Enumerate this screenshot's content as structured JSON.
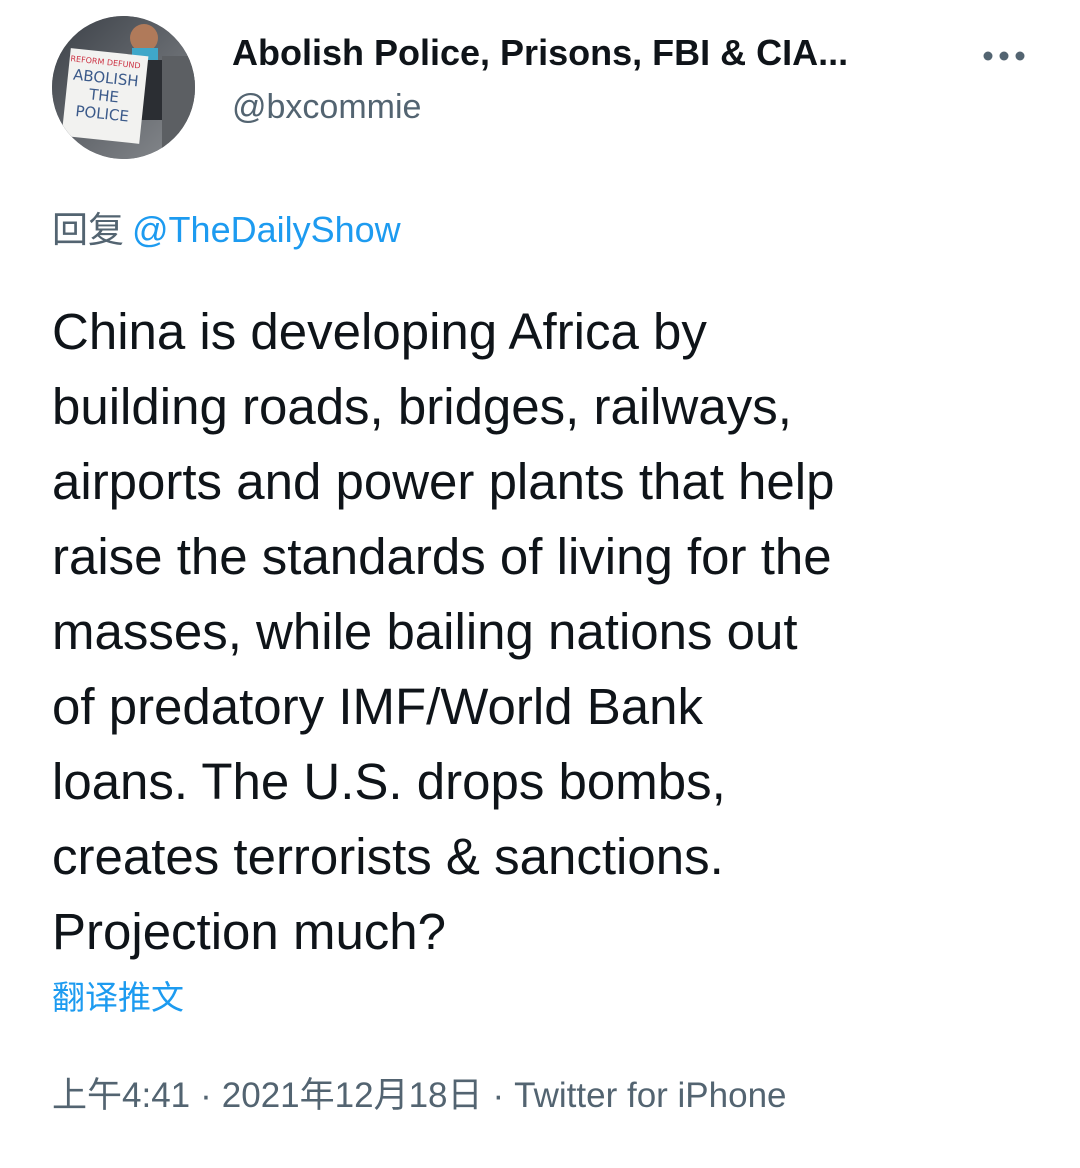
{
  "author": {
    "display_name": "Abolish Police, Prisons, FBI & CIA...",
    "handle": "@bxcommie",
    "avatar_sign_lines": [
      "REFORM DEFUND",
      "ABOLISH",
      "THE",
      "POLICE"
    ]
  },
  "reply": {
    "prefix": "回复",
    "target": "@TheDailyShow"
  },
  "tweet": {
    "lines": [
      "China is developing Africa by",
      "building roads, bridges, railways,",
      "airports and power plants that help",
      "raise the standards of living for the",
      "masses, while bailing nations out",
      "of predatory IMF/World Bank",
      "loans. The U.S. drops bombs,",
      "creates terrorists & sanctions.",
      "Projection much?"
    ]
  },
  "translate_label": "翻译推文",
  "meta": {
    "time": "上午4:41",
    "separator": "·",
    "date": "2021年12月18日",
    "source": "Twitter for iPhone"
  },
  "icons": {
    "more": "more-dots-icon"
  },
  "colors": {
    "text_primary": "#0f1419",
    "text_secondary": "#536471",
    "accent": "#1d9bf0"
  }
}
